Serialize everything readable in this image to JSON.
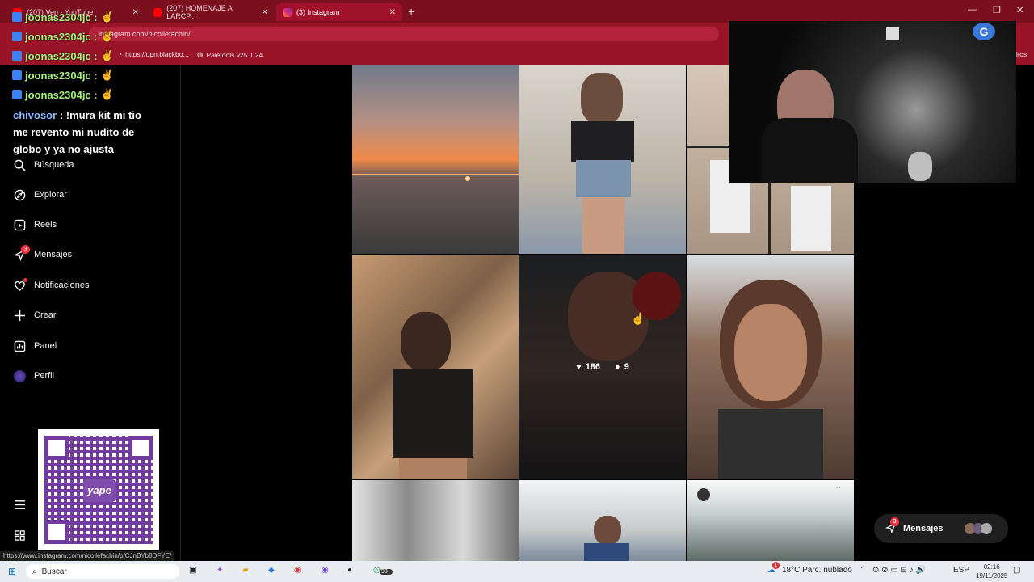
{
  "tabs": [
    {
      "title": "(207) Ven - YouTube",
      "active": false
    },
    {
      "title": "(207) HOMENAJE A LARCP...",
      "active": false
    },
    {
      "title": "(3) Instagram",
      "active": true
    }
  ],
  "address_bar": {
    "url": "instagram.com/nicollefachin/"
  },
  "bookmarks": [
    {
      "label": "https://upn.blackbo..."
    },
    {
      "label": "Paletools v25.1.24"
    },
    {
      "label": "itos"
    }
  ],
  "chat": {
    "lines": [
      {
        "user": "joonas2304jc :"
      },
      {
        "user": "joonas2304jc :"
      },
      {
        "user": "joonas2304jc :"
      },
      {
        "user": "joonas2304jc :"
      },
      {
        "user": "joonas2304jc :"
      }
    ],
    "message": {
      "user": "chivosor",
      "text": " : !mura kit mi tio me revento mi nudito de globo y ya no ajusta"
    }
  },
  "sidebar": {
    "items": [
      {
        "label": "Búsqueda",
        "icon": "search-icon"
      },
      {
        "label": "Explorar",
        "icon": "compass-icon"
      },
      {
        "label": "Reels",
        "icon": "reels-icon"
      },
      {
        "label": "Mensajes",
        "icon": "messenger-icon",
        "badge": "3"
      },
      {
        "label": "Notificaciones",
        "icon": "heart-icon"
      },
      {
        "label": "Crear",
        "icon": "plus-icon"
      },
      {
        "label": "Panel",
        "icon": "dashboard-icon"
      },
      {
        "label": "Perfil",
        "icon": "profile-avatar-icon"
      }
    ]
  },
  "hover_post": {
    "likes": "186",
    "comments": "9"
  },
  "qr": {
    "label": "yape"
  },
  "messages_pill": {
    "label": "Mensajes",
    "badge": "3"
  },
  "status_link": "https://www.instagram.com/nicollefachin/p/CJnBYb8DFYE/",
  "taskbar": {
    "search_placeholder": "Buscar",
    "weather": "18°C  Parc. nublado",
    "weather_badge": "1",
    "lang": "ESP",
    "time": "02:16",
    "date": "19/11/2025",
    "app_badge": "99+"
  },
  "colors": {
    "chrome_red": "#9a1428",
    "chat_green": "#a6f27a",
    "ig_badge": "#ff3040"
  }
}
